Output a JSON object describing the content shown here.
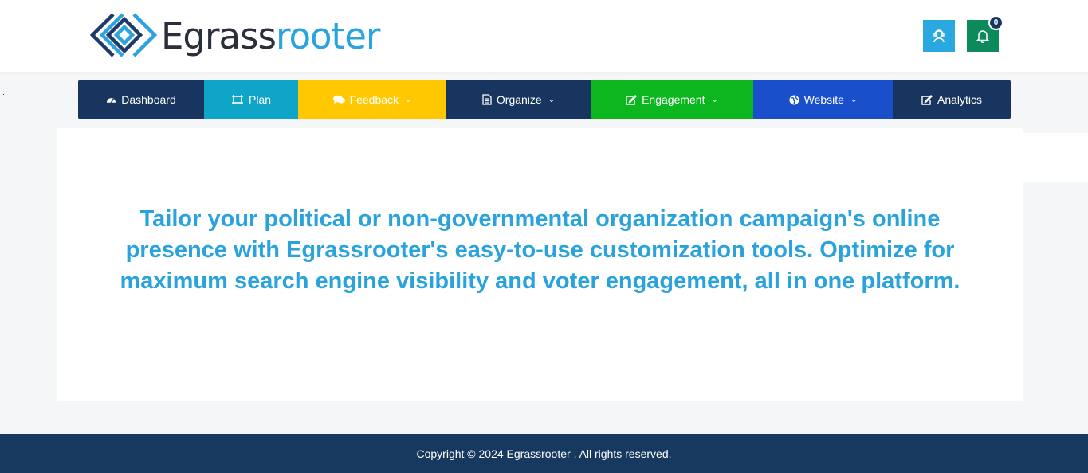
{
  "brand": {
    "name_part1": "Egrass",
    "name_part2": "rooter",
    "colors": {
      "dark": "#2a2f3a",
      "blue": "#2aa3e0"
    }
  },
  "header": {
    "profile_icon": "user-headset-icon",
    "notification_icon": "bell-icon",
    "notification_count": "0"
  },
  "nav": {
    "items": [
      {
        "label": "Dashboard",
        "icon": "gauge-icon",
        "color": "#17355e",
        "dropdown": false
      },
      {
        "label": "Plan",
        "icon": "crop-icon",
        "color": "#0ea5c9",
        "dropdown": false
      },
      {
        "label": "Feedback",
        "icon": "comments-icon",
        "color": "#ffc800",
        "dropdown": true
      },
      {
        "label": "Organize",
        "icon": "document-icon",
        "color": "#17355e",
        "dropdown": true
      },
      {
        "label": "Engagement",
        "icon": "edit-icon",
        "color": "#0bb61f",
        "dropdown": true
      },
      {
        "label": "Website",
        "icon": "globe-icon",
        "color": "#1a4fcc",
        "dropdown": true
      },
      {
        "label": "Analytics",
        "icon": "edit-icon",
        "color": "#17355e",
        "dropdown": false
      }
    ]
  },
  "main": {
    "hero_text": "Tailor your political or non-governmental organization campaign's online presence with Egrassrooter's easy-to-use customization tools. Optimize for maximum search engine visibility and voter engagement, all in one platform."
  },
  "footer": {
    "copyright": "Copyright © 2024 Egrassrooter . All rights reserved."
  }
}
